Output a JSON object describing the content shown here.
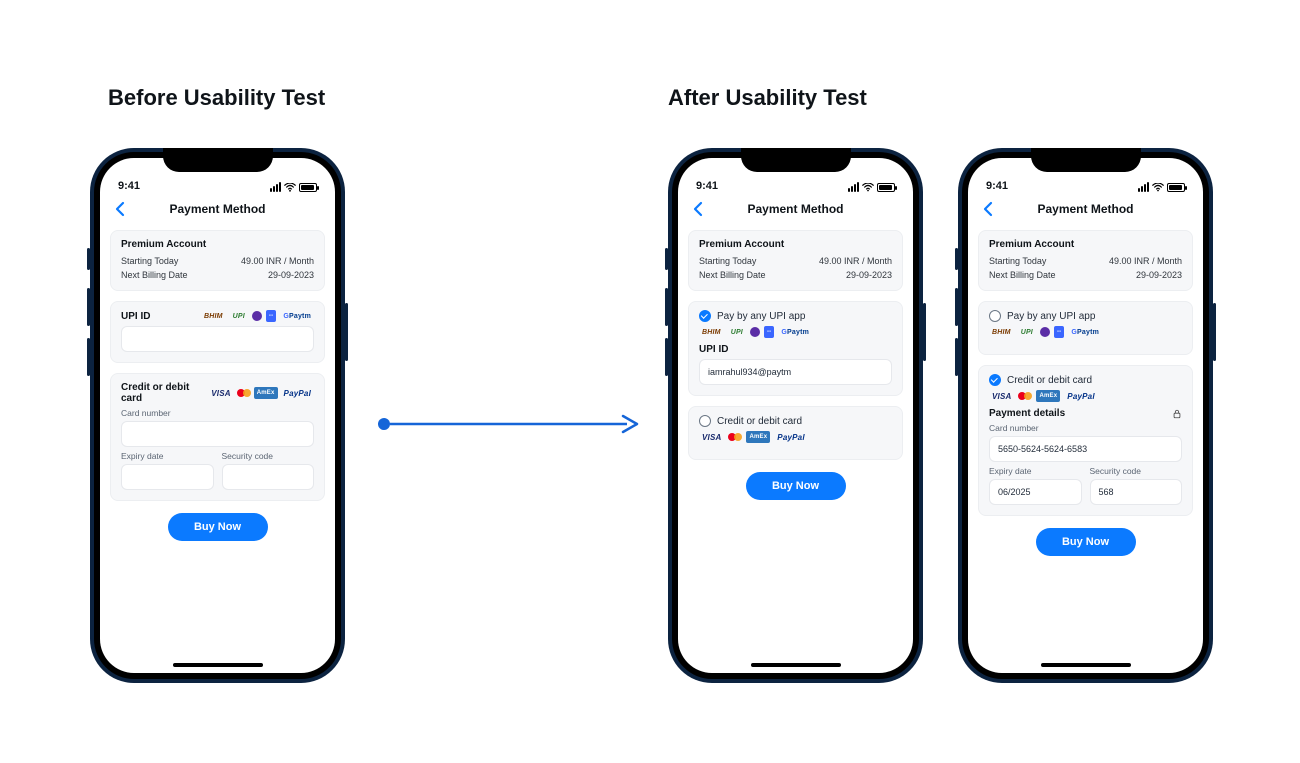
{
  "headings": {
    "before": "Before Usability Test",
    "after": "After Usability Test"
  },
  "statusbar": {
    "time": "9:41"
  },
  "header": {
    "title": "Payment Method"
  },
  "account": {
    "title": "Premium Account",
    "row1_label": "Starting Today",
    "row1_value": "49.00 INR / Month",
    "row2_label": "Next Billing Date",
    "row2_value": "29-09-2023"
  },
  "upi": {
    "label": "UPI ID",
    "pay_any_label": "Pay by any UPI app",
    "value_filled": "iamrahul934@paytm",
    "logos": {
      "bhim": "BHIM",
      "upi": "UPI",
      "hatch": "--",
      "gpay": "G",
      "paytm": "Paytm"
    }
  },
  "card": {
    "label": "Credit or debit card",
    "payment_details": "Payment details",
    "number_label": "Card number",
    "number_value": "5650-5624-5624-6583",
    "expiry_label": "Expiry date",
    "expiry_value": "06/2025",
    "cvv_label": "Security code",
    "cvv_value": "568",
    "logos": {
      "visa": "VISA",
      "amex": "AmEx",
      "paypal": "PayPal"
    }
  },
  "cta": {
    "buy": "Buy Now"
  }
}
